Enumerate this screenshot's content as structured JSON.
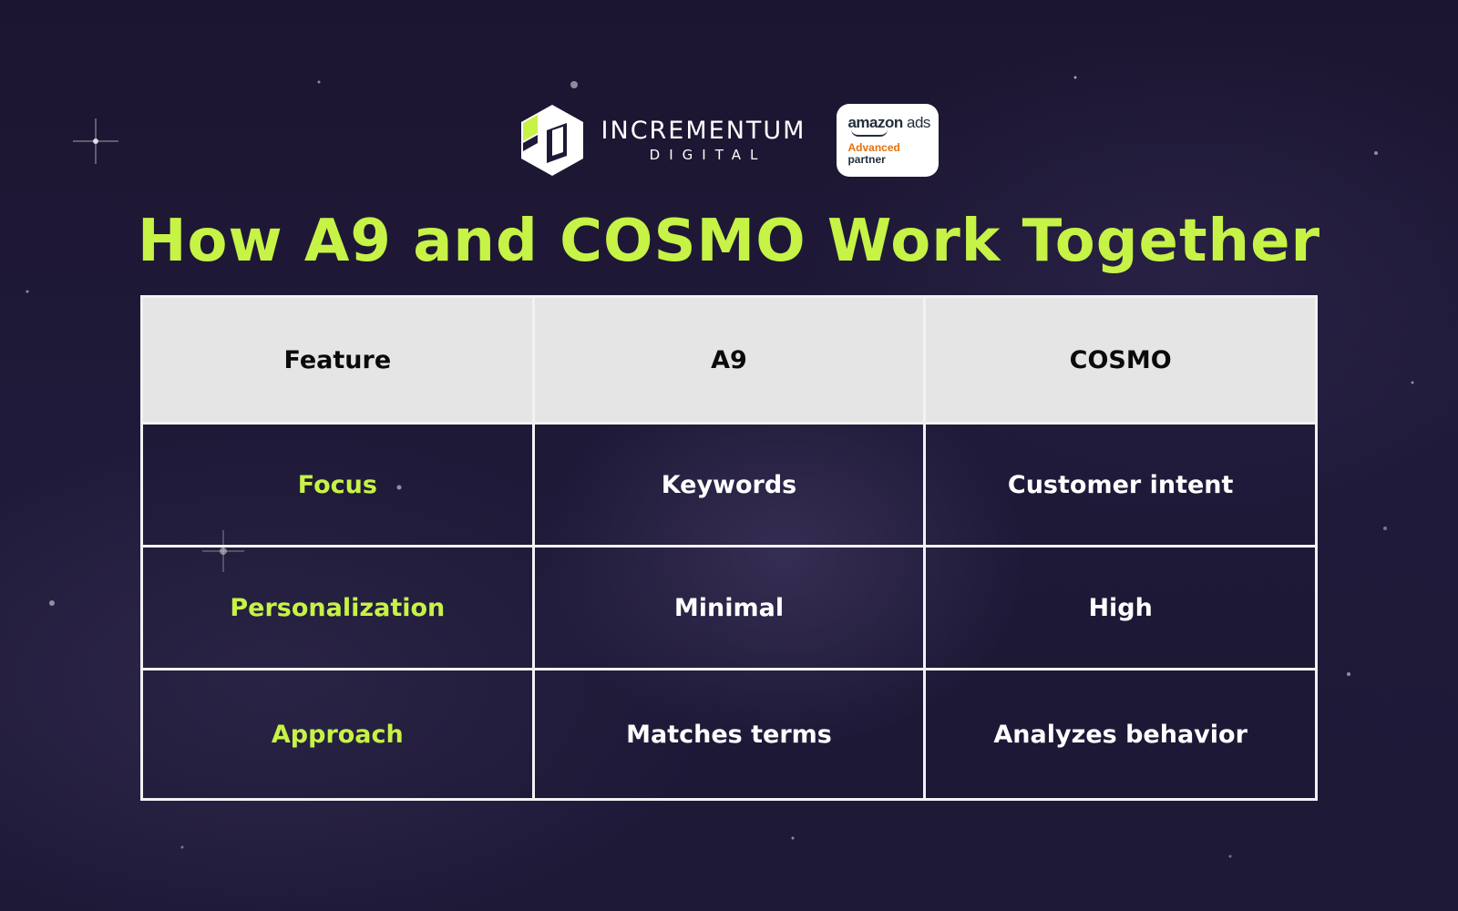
{
  "brand": {
    "name": "INCREMENTUM",
    "sub": "DIGITAL",
    "logo_icon": "incrementum-hexagon-logo",
    "accent_color": "#c6f346"
  },
  "partner_badge": {
    "brand": "amazon",
    "brand_suffix": "ads",
    "level": "Advanced",
    "type": "partner",
    "level_color": "#e8700a"
  },
  "title": "How A9 and COSMO Work Together",
  "table": {
    "headers": [
      "Feature",
      "A9",
      "COSMO"
    ],
    "rows": [
      {
        "feature": "Focus",
        "a9": "Keywords",
        "cosmo": "Customer intent"
      },
      {
        "feature": "Personalization",
        "a9": "Minimal",
        "cosmo": "High"
      },
      {
        "feature": "Approach",
        "a9": "Matches terms",
        "cosmo": "Analyzes behavior"
      }
    ]
  },
  "colors": {
    "title": "#c6f346",
    "header_bg": "#e5e5e6",
    "background": "#1f1938"
  }
}
